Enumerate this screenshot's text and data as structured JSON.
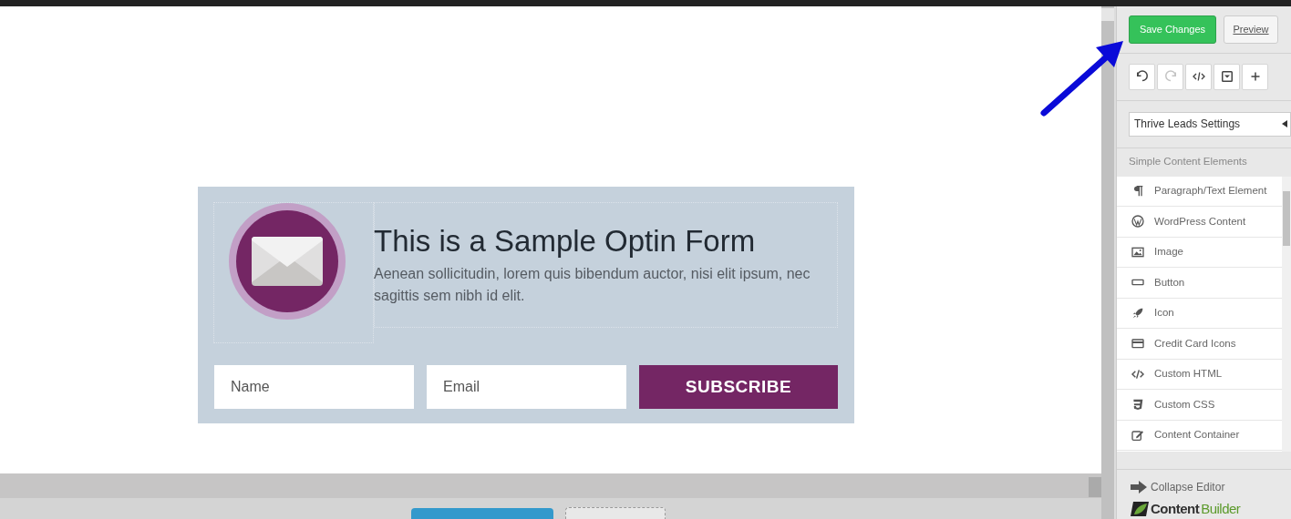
{
  "form": {
    "title": "This is a Sample Optin Form",
    "text": "Aenean sollicitudin, lorem quis bibendum auctor, nisi elit ipsum, nec sagittis sem nibh id elit.",
    "fields": [
      {
        "placeholder": "Name"
      },
      {
        "placeholder": "Email"
      }
    ],
    "button": "SUBSCRIBE"
  },
  "sidebar": {
    "save": "Save Changes",
    "preview": "Preview",
    "toolbar": [
      {
        "kind": "undo",
        "disabled": false
      },
      {
        "kind": "redo",
        "disabled": true
      },
      {
        "kind": "code",
        "disabled": false
      },
      {
        "kind": "dropdown",
        "disabled": false
      },
      {
        "kind": "add",
        "disabled": false
      }
    ],
    "settings": "Thrive Leads Settings",
    "section": "Simple Content Elements",
    "items": [
      {
        "kind": "paragraph",
        "label": "Paragraph/Text Element"
      },
      {
        "kind": "wordpress",
        "label": "WordPress Content"
      },
      {
        "kind": "image",
        "label": "Image"
      },
      {
        "kind": "button",
        "label": "Button"
      },
      {
        "kind": "rocket",
        "label": "Icon"
      },
      {
        "kind": "card",
        "label": "Credit Card Icons"
      },
      {
        "kind": "code",
        "label": "Custom HTML"
      },
      {
        "kind": "css",
        "label": "Custom CSS"
      },
      {
        "kind": "edit",
        "label": "Content Container"
      }
    ],
    "collapse": "Collapse Editor",
    "logo_a": "Content",
    "logo_b": "Builder"
  }
}
